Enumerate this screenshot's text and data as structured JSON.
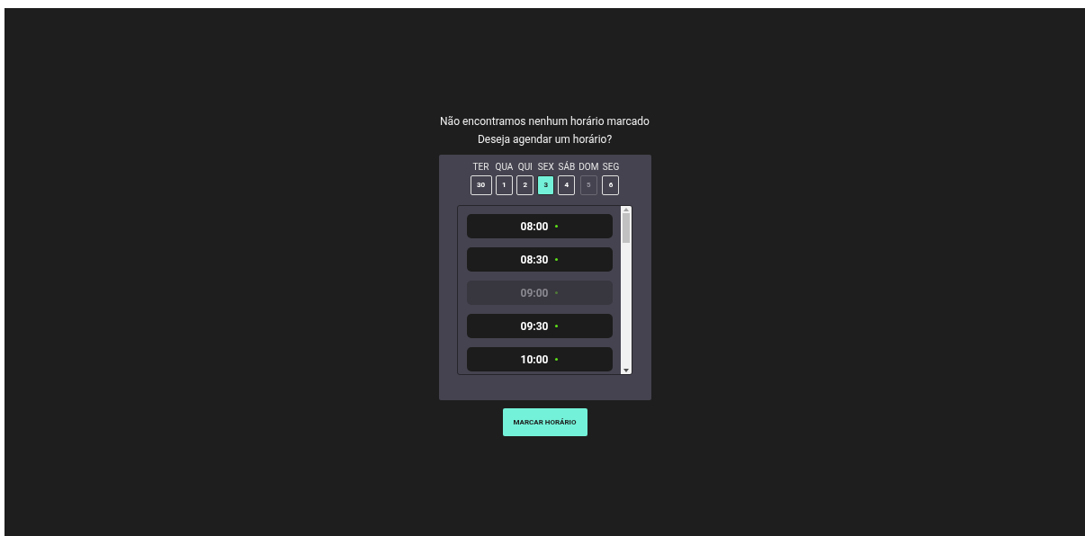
{
  "message": [
    "Não encontramos nenhum horário marcado",
    "Deseja agendar um horário?"
  ],
  "days": [
    {
      "weekday": "TER",
      "day": "30",
      "selected": false,
      "disabled": false
    },
    {
      "weekday": "QUA",
      "day": "1",
      "selected": false,
      "disabled": false
    },
    {
      "weekday": "QUI",
      "day": "2",
      "selected": false,
      "disabled": false
    },
    {
      "weekday": "SEX",
      "day": "3",
      "selected": true,
      "disabled": false
    },
    {
      "weekday": "SÁB",
      "day": "4",
      "selected": false,
      "disabled": false
    },
    {
      "weekday": "DOM",
      "day": "5",
      "selected": false,
      "disabled": true
    },
    {
      "weekday": "SEG",
      "day": "6",
      "selected": false,
      "disabled": false
    }
  ],
  "times": [
    {
      "time": "08:00",
      "disabled": false
    },
    {
      "time": "08:30",
      "disabled": false
    },
    {
      "time": "09:00",
      "disabled": true
    },
    {
      "time": "09:30",
      "disabled": false
    },
    {
      "time": "10:00",
      "disabled": false
    }
  ],
  "button": "MARCAR HORÁRIO"
}
